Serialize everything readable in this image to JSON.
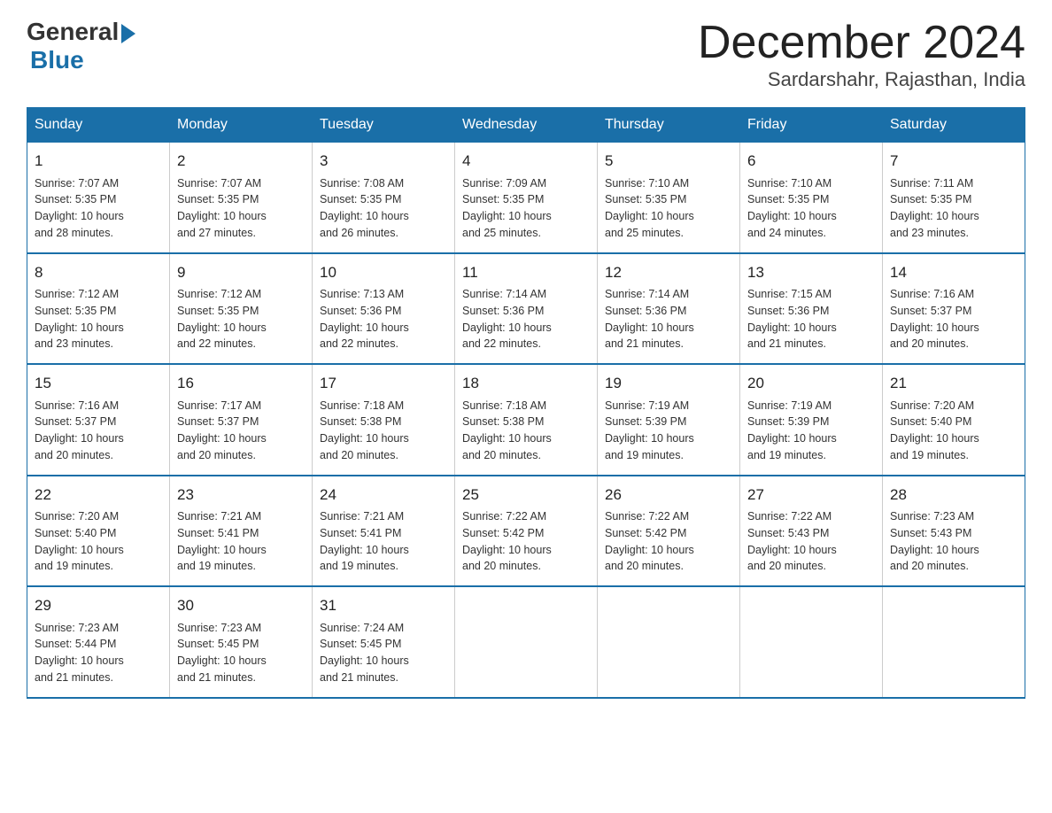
{
  "logo": {
    "general": "General",
    "blue": "Blue",
    "arrow": "▶"
  },
  "title": "December 2024",
  "subtitle": "Sardarshahr, Rajasthan, India",
  "days_of_week": [
    "Sunday",
    "Monday",
    "Tuesday",
    "Wednesday",
    "Thursday",
    "Friday",
    "Saturday"
  ],
  "weeks": [
    [
      {
        "day": "1",
        "sunrise": "7:07 AM",
        "sunset": "5:35 PM",
        "daylight": "10 hours and 28 minutes."
      },
      {
        "day": "2",
        "sunrise": "7:07 AM",
        "sunset": "5:35 PM",
        "daylight": "10 hours and 27 minutes."
      },
      {
        "day": "3",
        "sunrise": "7:08 AM",
        "sunset": "5:35 PM",
        "daylight": "10 hours and 26 minutes."
      },
      {
        "day": "4",
        "sunrise": "7:09 AM",
        "sunset": "5:35 PM",
        "daylight": "10 hours and 25 minutes."
      },
      {
        "day": "5",
        "sunrise": "7:10 AM",
        "sunset": "5:35 PM",
        "daylight": "10 hours and 25 minutes."
      },
      {
        "day": "6",
        "sunrise": "7:10 AM",
        "sunset": "5:35 PM",
        "daylight": "10 hours and 24 minutes."
      },
      {
        "day": "7",
        "sunrise": "7:11 AM",
        "sunset": "5:35 PM",
        "daylight": "10 hours and 23 minutes."
      }
    ],
    [
      {
        "day": "8",
        "sunrise": "7:12 AM",
        "sunset": "5:35 PM",
        "daylight": "10 hours and 23 minutes."
      },
      {
        "day": "9",
        "sunrise": "7:12 AM",
        "sunset": "5:35 PM",
        "daylight": "10 hours and 22 minutes."
      },
      {
        "day": "10",
        "sunrise": "7:13 AM",
        "sunset": "5:36 PM",
        "daylight": "10 hours and 22 minutes."
      },
      {
        "day": "11",
        "sunrise": "7:14 AM",
        "sunset": "5:36 PM",
        "daylight": "10 hours and 22 minutes."
      },
      {
        "day": "12",
        "sunrise": "7:14 AM",
        "sunset": "5:36 PM",
        "daylight": "10 hours and 21 minutes."
      },
      {
        "day": "13",
        "sunrise": "7:15 AM",
        "sunset": "5:36 PM",
        "daylight": "10 hours and 21 minutes."
      },
      {
        "day": "14",
        "sunrise": "7:16 AM",
        "sunset": "5:37 PM",
        "daylight": "10 hours and 20 minutes."
      }
    ],
    [
      {
        "day": "15",
        "sunrise": "7:16 AM",
        "sunset": "5:37 PM",
        "daylight": "10 hours and 20 minutes."
      },
      {
        "day": "16",
        "sunrise": "7:17 AM",
        "sunset": "5:37 PM",
        "daylight": "10 hours and 20 minutes."
      },
      {
        "day": "17",
        "sunrise": "7:18 AM",
        "sunset": "5:38 PM",
        "daylight": "10 hours and 20 minutes."
      },
      {
        "day": "18",
        "sunrise": "7:18 AM",
        "sunset": "5:38 PM",
        "daylight": "10 hours and 20 minutes."
      },
      {
        "day": "19",
        "sunrise": "7:19 AM",
        "sunset": "5:39 PM",
        "daylight": "10 hours and 19 minutes."
      },
      {
        "day": "20",
        "sunrise": "7:19 AM",
        "sunset": "5:39 PM",
        "daylight": "10 hours and 19 minutes."
      },
      {
        "day": "21",
        "sunrise": "7:20 AM",
        "sunset": "5:40 PM",
        "daylight": "10 hours and 19 minutes."
      }
    ],
    [
      {
        "day": "22",
        "sunrise": "7:20 AM",
        "sunset": "5:40 PM",
        "daylight": "10 hours and 19 minutes."
      },
      {
        "day": "23",
        "sunrise": "7:21 AM",
        "sunset": "5:41 PM",
        "daylight": "10 hours and 19 minutes."
      },
      {
        "day": "24",
        "sunrise": "7:21 AM",
        "sunset": "5:41 PM",
        "daylight": "10 hours and 19 minutes."
      },
      {
        "day": "25",
        "sunrise": "7:22 AM",
        "sunset": "5:42 PM",
        "daylight": "10 hours and 20 minutes."
      },
      {
        "day": "26",
        "sunrise": "7:22 AM",
        "sunset": "5:42 PM",
        "daylight": "10 hours and 20 minutes."
      },
      {
        "day": "27",
        "sunrise": "7:22 AM",
        "sunset": "5:43 PM",
        "daylight": "10 hours and 20 minutes."
      },
      {
        "day": "28",
        "sunrise": "7:23 AM",
        "sunset": "5:43 PM",
        "daylight": "10 hours and 20 minutes."
      }
    ],
    [
      {
        "day": "29",
        "sunrise": "7:23 AM",
        "sunset": "5:44 PM",
        "daylight": "10 hours and 21 minutes."
      },
      {
        "day": "30",
        "sunrise": "7:23 AM",
        "sunset": "5:45 PM",
        "daylight": "10 hours and 21 minutes."
      },
      {
        "day": "31",
        "sunrise": "7:24 AM",
        "sunset": "5:45 PM",
        "daylight": "10 hours and 21 minutes."
      },
      null,
      null,
      null,
      null
    ]
  ],
  "labels": {
    "sunrise": "Sunrise:",
    "sunset": "Sunset:",
    "daylight": "Daylight:"
  }
}
